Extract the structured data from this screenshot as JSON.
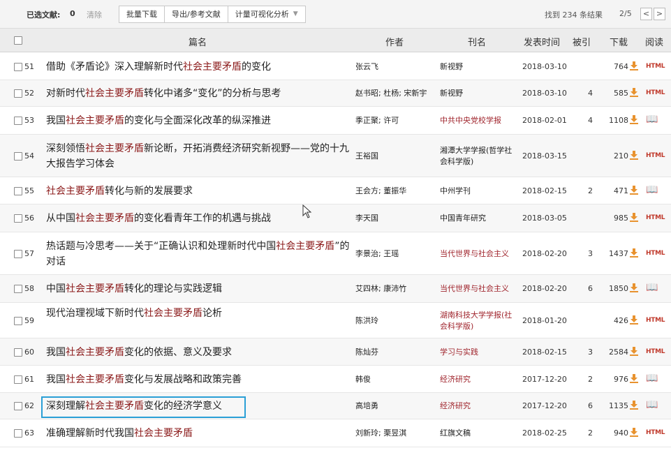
{
  "toolbar": {
    "selected_label": "已选文献:",
    "selected_count": "0",
    "clear": "清除",
    "bulk_download": "批量下载",
    "export": "导出/参考文献",
    "visualize": "计量可视化分析",
    "found_text": "找到 234 条结果",
    "page": "2/5",
    "prev": "<",
    "next": ">"
  },
  "header": {
    "title": "篇名",
    "author": "作者",
    "journal": "刊名",
    "date": "发表时间",
    "cited": "被引",
    "downloads": "下载",
    "read": "阅读"
  },
  "colors": {
    "highlight": "#8b1a1a",
    "journal_red": "#a0252d",
    "focus_border": "#2a9fd6"
  },
  "rows": [
    {
      "num": "51",
      "t_pre": "借助《矛盾论》深入理解新时代",
      "t_hl": "社会主要矛盾",
      "t_post": "的变化",
      "author": "张云飞",
      "journal": "新视野",
      "date": "2018-03-10",
      "cited": "",
      "downloads": "764",
      "read": "HTML"
    },
    {
      "num": "52",
      "t_pre": "对新时代",
      "t_hl": "社会主要矛盾",
      "t_post": "转化中诸多“变化”的分析与思考",
      "author": "赵书昭; 杜杨; 宋新宇",
      "journal": "新视野",
      "date": "2018-03-10",
      "cited": "4",
      "downloads": "585",
      "read": "HTML"
    },
    {
      "num": "53",
      "t_pre": "我国",
      "t_hl": "社会主要矛盾",
      "t_post": "的变化与全面深化改革的纵深推进",
      "author": "季正聚; 许可",
      "journal": "中共中央党校学报",
      "date": "2018-02-01",
      "cited": "4",
      "downloads": "1108",
      "read": "📖"
    },
    {
      "num": "54",
      "t_pre": "深刻领悟",
      "t_hl": "社会主要矛盾",
      "t_post": "新论断，开拓消费经济研究新视野——党的十九大报告学习体会",
      "author": "王裕国",
      "journal": "湘潭大学学报(哲学社会科学版)",
      "date": "2018-03-15",
      "cited": "",
      "downloads": "210",
      "read": "HTML"
    },
    {
      "num": "55",
      "t_pre": "",
      "t_hl": "社会主要矛盾",
      "t_post": "转化与新的发展要求",
      "author": "王会方; 董振华",
      "journal": "中州学刊",
      "date": "2018-02-15",
      "cited": "2",
      "downloads": "471",
      "read": "📖"
    },
    {
      "num": "56",
      "t_pre": "从中国",
      "t_hl": "社会主要矛盾",
      "t_post": "的变化看青年工作的机遇与挑战",
      "author": "李天国",
      "journal": "中国青年研究",
      "date": "2018-03-05",
      "cited": "",
      "downloads": "985",
      "read": "HTML"
    },
    {
      "num": "57",
      "t_pre": "热话题与冷思考——关于“正确认识和处理新时代中国",
      "t_hl": "社会主要矛盾",
      "t_post": "”的对话",
      "author": "李景治; 王瑶",
      "journal": "当代世界与社会主义",
      "date": "2018-02-20",
      "cited": "3",
      "downloads": "1437",
      "read": "HTML"
    },
    {
      "num": "58",
      "t_pre": "中国",
      "t_hl": "社会主要矛盾",
      "t_post": "转化的理论与实践逻辑",
      "author": "艾四林; 康沛竹",
      "journal": "当代世界与社会主义",
      "date": "2018-02-20",
      "cited": "6",
      "downloads": "1850",
      "read": "📖"
    },
    {
      "num": "59",
      "t_pre": "现代治理视域下新时代",
      "t_hl": "社会主要矛盾",
      "t_post": "论析",
      "author": "陈洪玲",
      "journal": "湖南科技大学学报(社会科学版)",
      "date": "2018-01-20",
      "cited": "",
      "downloads": "426",
      "read": "HTML"
    },
    {
      "num": "60",
      "t_pre": "我国",
      "t_hl": "社会主要矛盾",
      "t_post": "变化的依据、意义及要求",
      "author": "陈灿芬",
      "journal": "学习与实践",
      "date": "2018-02-15",
      "cited": "3",
      "downloads": "2584",
      "read": "HTML"
    },
    {
      "num": "61",
      "t_pre": "我国",
      "t_hl": "社会主要矛盾",
      "t_post": "变化与发展战略和政策完善",
      "author": "韩俊",
      "journal": "经济研究",
      "date": "2017-12-20",
      "cited": "2",
      "downloads": "976",
      "read": "📖"
    },
    {
      "num": "62",
      "t_pre": "深刻理解",
      "t_hl": "社会主要矛盾",
      "t_post": "变化的经济学意义",
      "author": "高培勇",
      "journal": "经济研究",
      "date": "2017-12-20",
      "cited": "6",
      "downloads": "1135",
      "read": "📖"
    },
    {
      "num": "63",
      "t_pre": "准确理解新时代我国",
      "t_hl": "社会主要矛盾",
      "t_post": "",
      "author": "刘新玲; 栗昱淇",
      "journal": "红旗文稿",
      "date": "2018-02-25",
      "cited": "2",
      "downloads": "940",
      "read": "HTML"
    }
  ]
}
